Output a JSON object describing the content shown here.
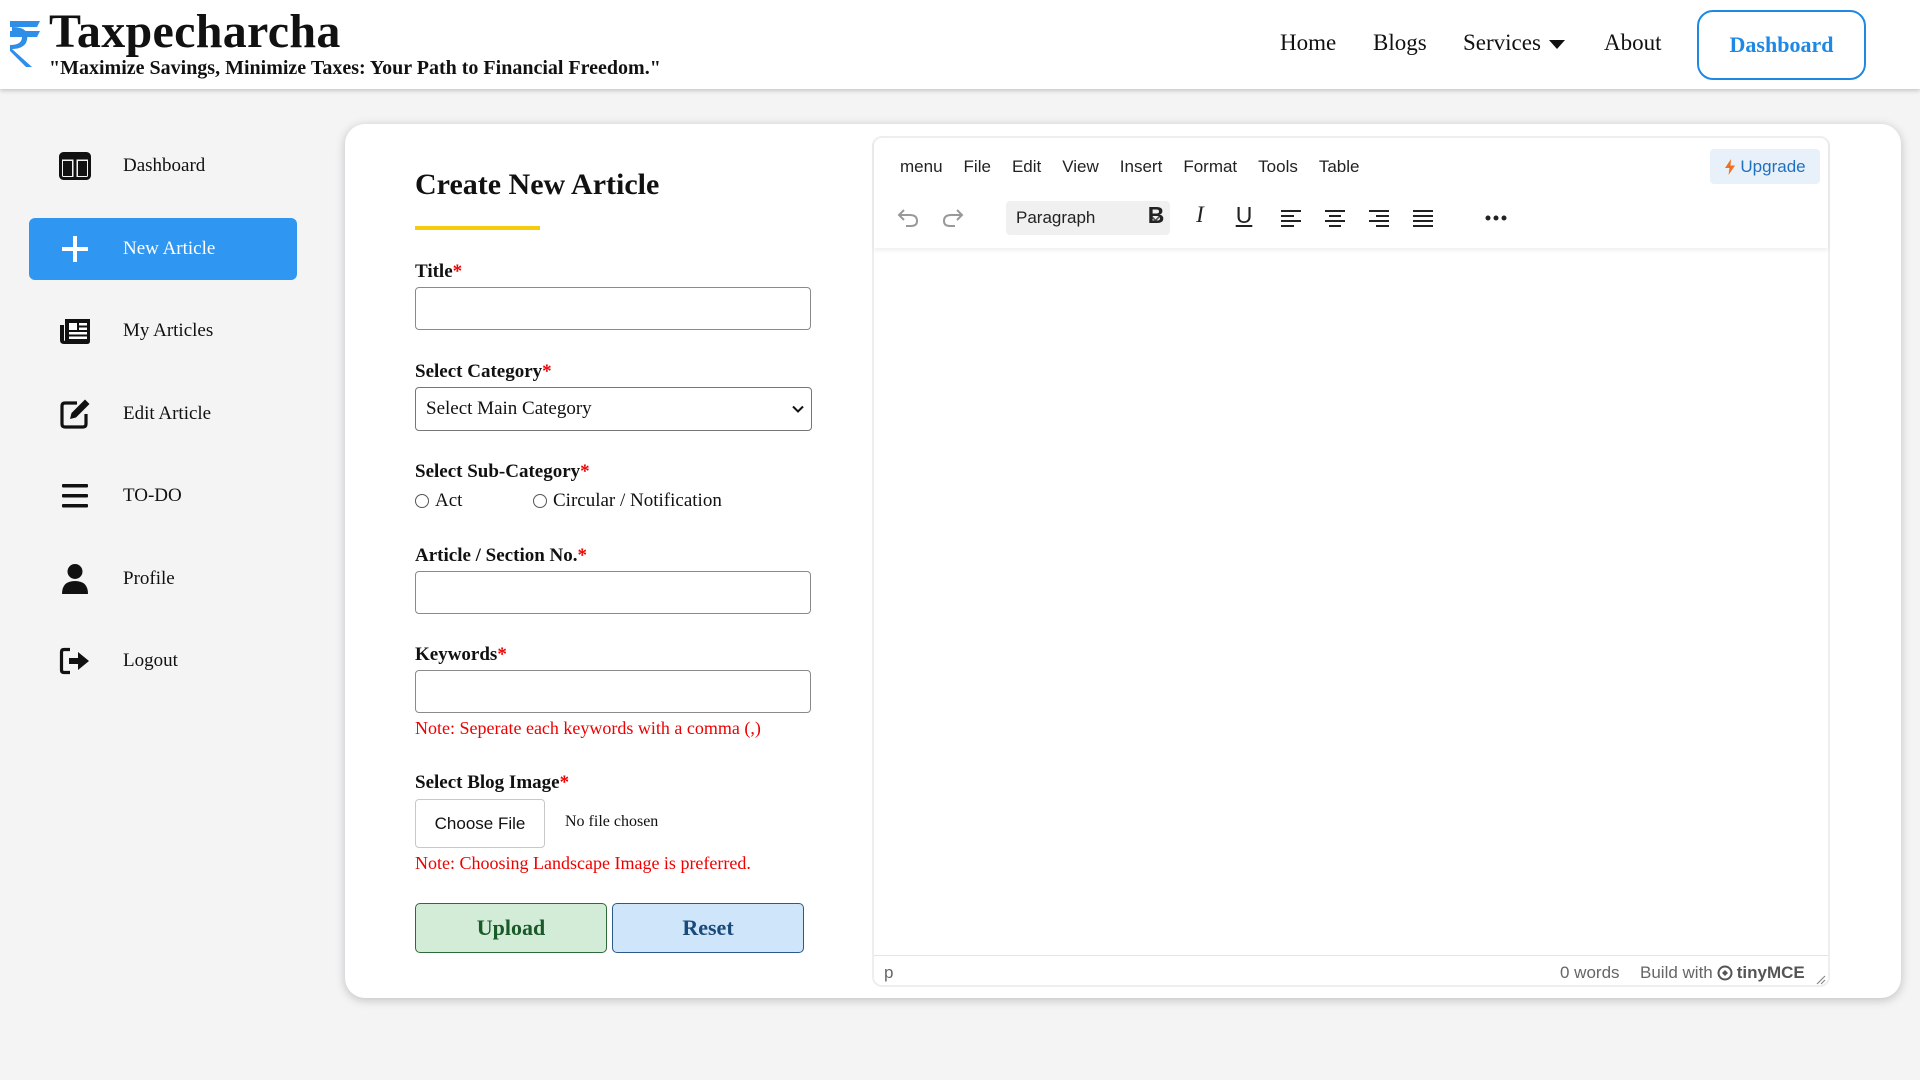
{
  "header": {
    "brand": "Taxpecharcha",
    "tagline": "\"Maximize Savings, Minimize Taxes: Your Path to Financial Freedom.\"",
    "logo_icon": "rupee-icon",
    "nav": {
      "home": "Home",
      "blogs": "Blogs",
      "services": "Services",
      "about": "About"
    },
    "dashboard_button": "Dashboard",
    "accent_color": "#1e88e5"
  },
  "sidebar": {
    "items": [
      {
        "label": "Dashboard",
        "icon": "columns-icon"
      },
      {
        "label": "New Article",
        "icon": "plus-icon",
        "active": true
      },
      {
        "label": "My Articles",
        "icon": "newspaper-icon"
      },
      {
        "label": "Edit Article",
        "icon": "edit-icon"
      },
      {
        "label": "TO-DO",
        "icon": "list-icon"
      },
      {
        "label": "Profile",
        "icon": "user-icon"
      },
      {
        "label": "Logout",
        "icon": "logout-icon"
      }
    ],
    "active_color": "#2f96f2"
  },
  "form": {
    "title": "Create New Article",
    "fields": {
      "title_label": "Title",
      "category_label": "Select Category",
      "category_value": "Select Main Category",
      "subcategory_label": "Select Sub-Category",
      "subcategory_options": [
        "Act",
        "Circular / Notification"
      ],
      "section_label": "Article / Section No.",
      "keywords_label": "Keywords",
      "keywords_note": "Note: Seperate each keywords with a comma (,)",
      "image_label": "Select Blog Image",
      "choose_file": "Choose File",
      "no_file": "No file chosen",
      "image_note": "Note: Choosing Landscape Image is preferred."
    },
    "required_mark": "*",
    "upload_button": "Upload",
    "reset_button": "Reset"
  },
  "editor": {
    "menu": [
      "menu",
      "File",
      "Edit",
      "View",
      "Insert",
      "Format",
      "Tools",
      "Table"
    ],
    "upgrade": "Upgrade",
    "block_format": "Paragraph",
    "bold": "B",
    "italic": "I",
    "underline": "U",
    "status_path": "p",
    "word_count": "0 words",
    "build_with": "Build with",
    "tinymce": "tinyMCE"
  }
}
